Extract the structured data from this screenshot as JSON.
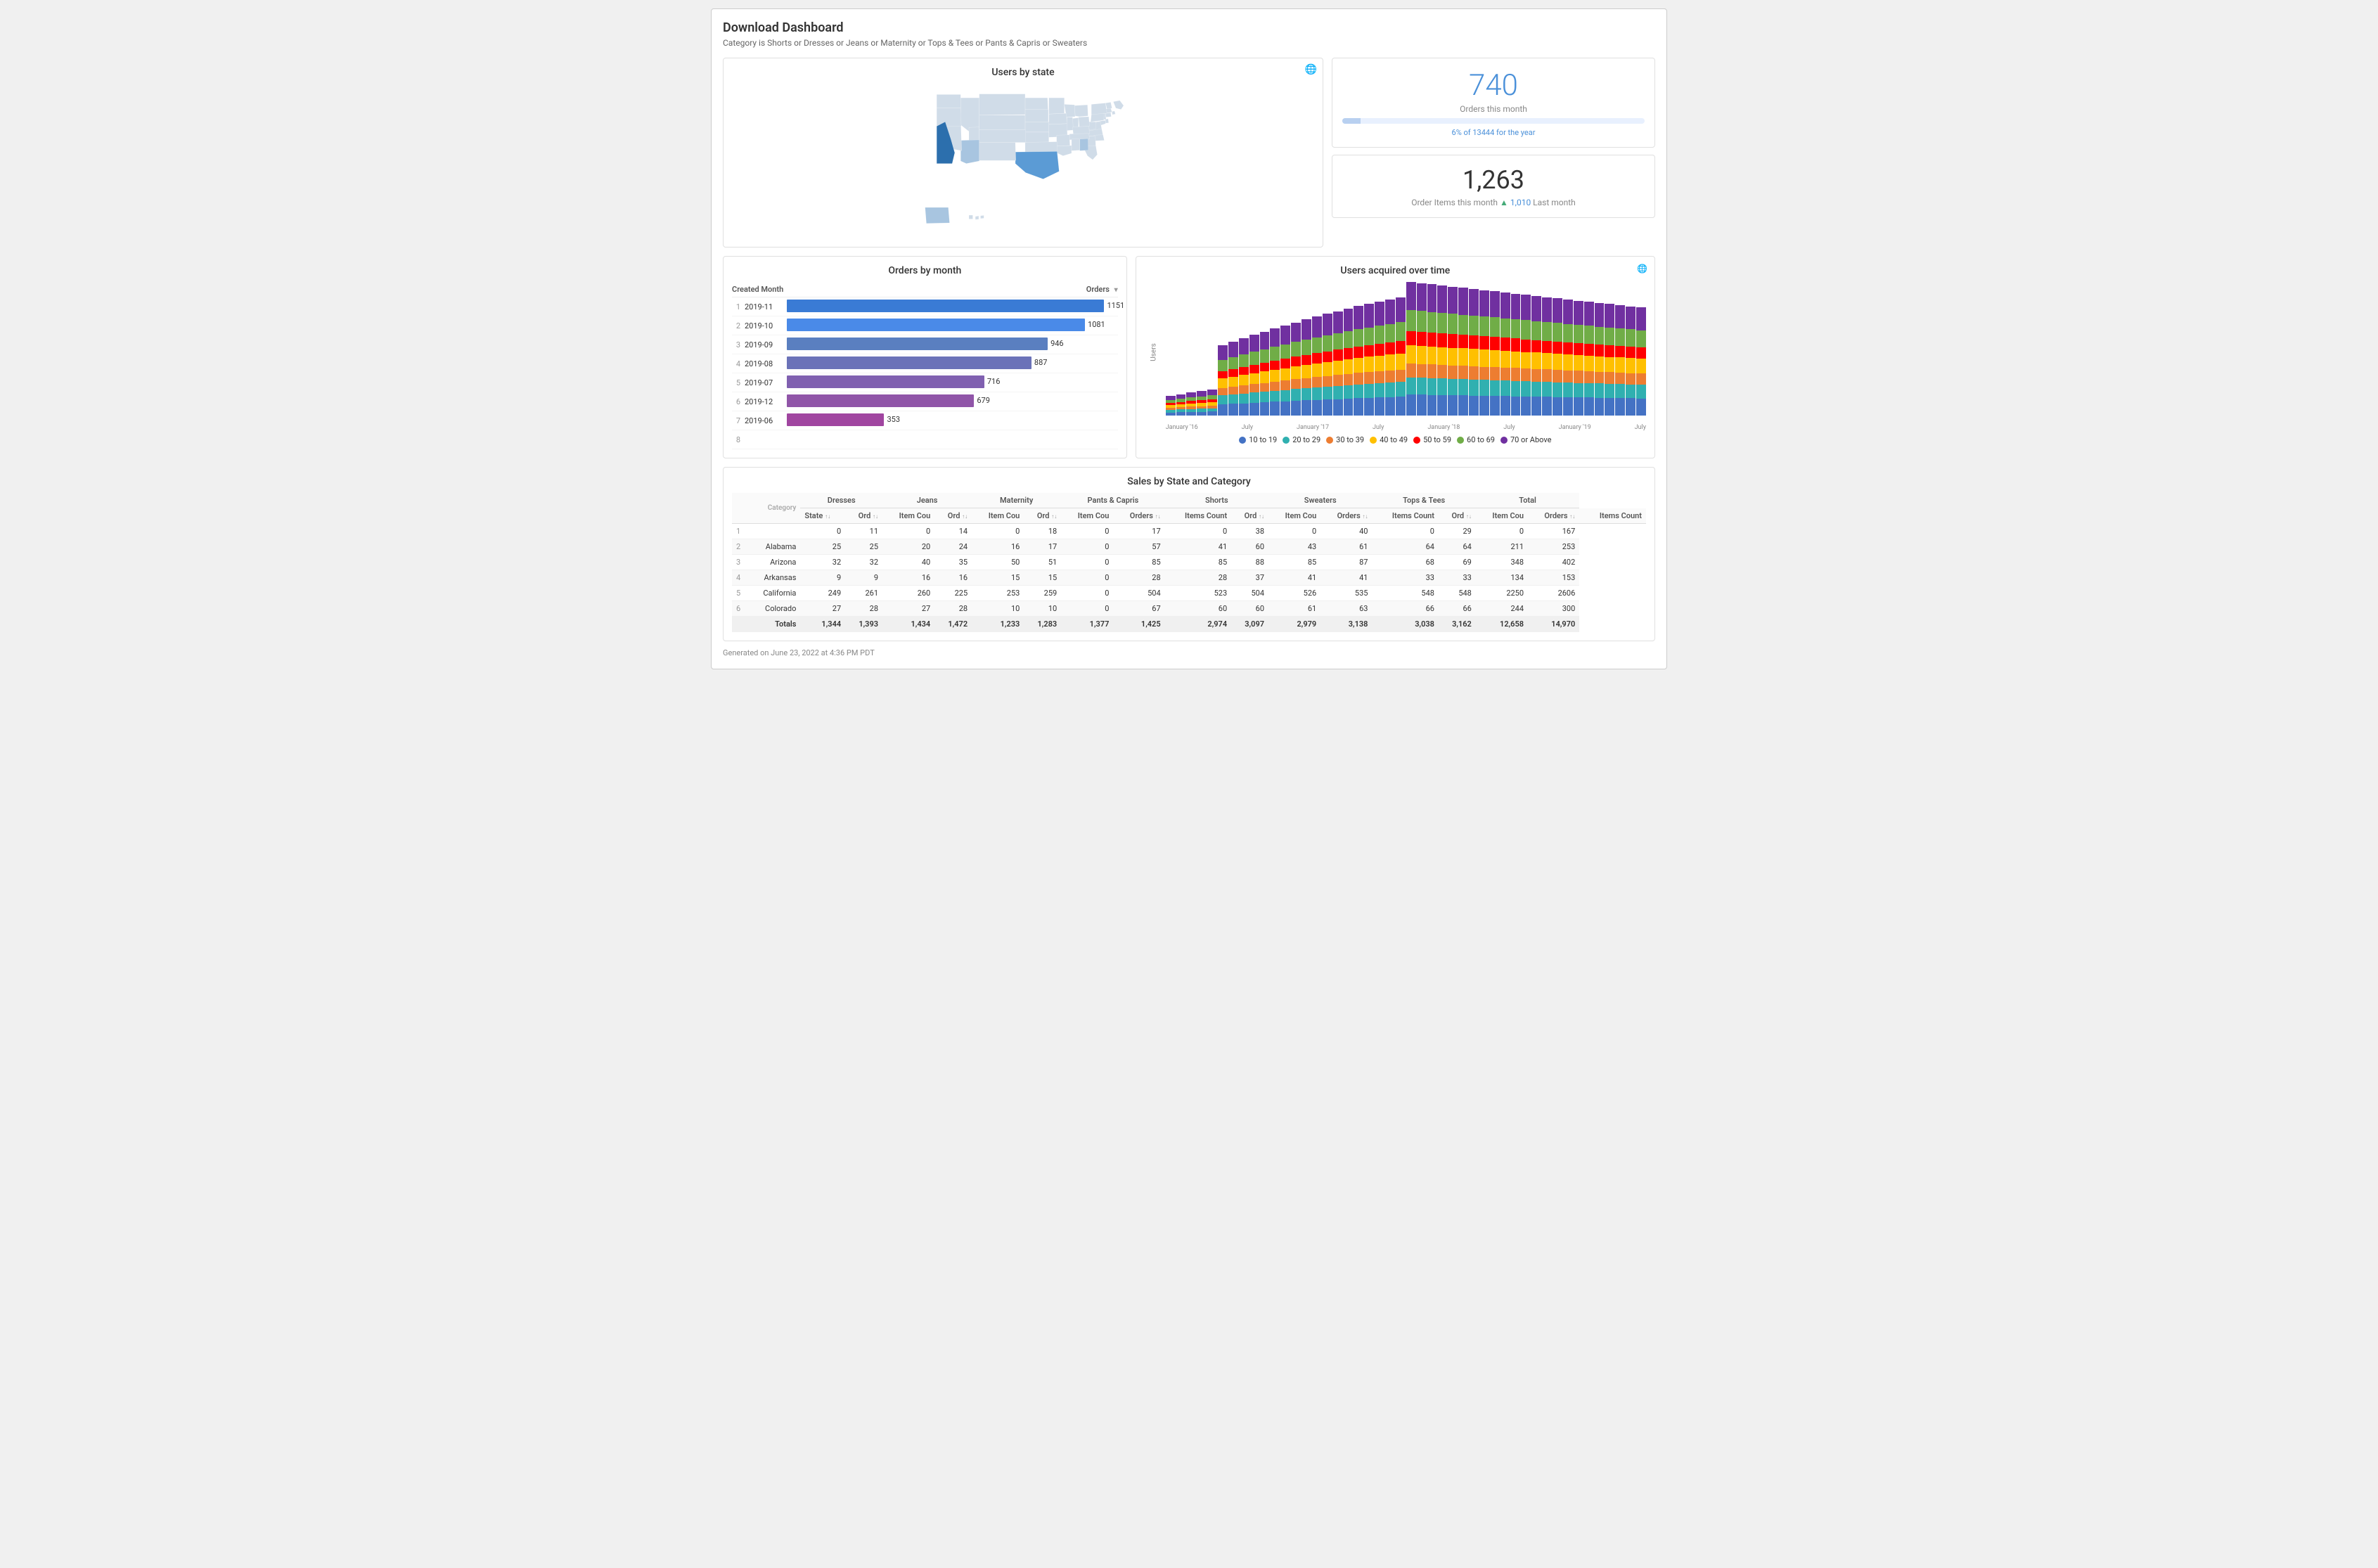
{
  "dashboard": {
    "title": "Download Dashboard",
    "subtitle": "Category is Shorts or Dresses or Jeans or Maternity or Tops & Tees or Pants & Capris or Sweaters",
    "footer": "Generated on June 23, 2022 at 4:36 PM PDT"
  },
  "map": {
    "title": "Users by state"
  },
  "metrics": {
    "orders_number": "740",
    "orders_label": "Orders this month",
    "year_label": "6% of 13444 for the year",
    "items_number": "1,263",
    "items_label": "Order Items this month",
    "items_sub": "Last month",
    "items_last_month": "1,010"
  },
  "orders_chart": {
    "title": "Orders by month",
    "col1": "Created Month",
    "col2": "Orders",
    "rows": [
      {
        "num": "1",
        "month": "2019-11",
        "value": 1151,
        "max": 1200
      },
      {
        "num": "2",
        "month": "2019-10",
        "value": 1081,
        "max": 1200
      },
      {
        "num": "3",
        "month": "2019-09",
        "value": 946,
        "max": 1200
      },
      {
        "num": "4",
        "month": "2019-08",
        "value": 887,
        "max": 1200
      },
      {
        "num": "5",
        "month": "2019-07",
        "value": 716,
        "max": 1200
      },
      {
        "num": "6",
        "month": "2019-12",
        "value": 679,
        "max": 1200
      },
      {
        "num": "7",
        "month": "2019-06",
        "value": 353,
        "max": 1200
      },
      {
        "num": "8",
        "month": "",
        "value": 0,
        "max": 1200
      }
    ],
    "bar_colors": [
      "#3a7bd5",
      "#4a8ae8",
      "#5a7fc0",
      "#6b72b8",
      "#8060b0",
      "#9055a8",
      "#a045a0",
      "#b03898"
    ]
  },
  "users_chart": {
    "title": "Users acquired over time",
    "y_label": "Users",
    "y_max": 250,
    "x_labels": [
      "January '16",
      "July",
      "January '17",
      "July",
      "January '18",
      "July",
      "January '19",
      "July"
    ],
    "legend": [
      {
        "label": "10 to 19",
        "color": "#4472c4"
      },
      {
        "label": "20 to 29",
        "color": "#30b0b0"
      },
      {
        "label": "30 to 39",
        "color": "#ed7d31"
      },
      {
        "label": "40 to 49",
        "color": "#ffc000"
      },
      {
        "label": "50 to 59",
        "color": "#ff0000"
      },
      {
        "label": "60 to 69",
        "color": "#70ad47"
      },
      {
        "label": "70 or Above",
        "color": "#7030a0"
      }
    ]
  },
  "sales_table": {
    "title": "Sales by State and Category",
    "categories": [
      "Dresses",
      "Jeans",
      "Maternity",
      "Pants & Capris",
      "Shorts",
      "Sweaters",
      "Tops & Tees",
      "Total"
    ],
    "sub_cols": [
      "Orders",
      "Items Count"
    ],
    "rows": [
      {
        "num": "1",
        "state": "",
        "dresses_ord": 0,
        "dresses_ic": 11,
        "jeans_ord": 0,
        "jeans_ic": 14,
        "mat_ord": 0,
        "mat_ic": 18,
        "pc_ord": 0,
        "pc_ic": 17,
        "shorts_ord": 0,
        "shorts_ic": 38,
        "sw_ord": 0,
        "sw_ic": 40,
        "tt_ord": 0,
        "tt_ic": 29,
        "tot_ord": 0,
        "tot_ic": 167
      },
      {
        "num": "2",
        "state": "Alabama",
        "dresses_ord": 25,
        "dresses_ic": 25,
        "jeans_ord": 20,
        "jeans_ic": 24,
        "mat_ord": 16,
        "mat_ic": 17,
        "pc_ord": 0,
        "pc_ic": 57,
        "shorts_ord": 41,
        "shorts_ic": 60,
        "sw_ord": 43,
        "sw_ic": 61,
        "tt_ord": 64,
        "tt_ic": 64,
        "tot_ord": 211,
        "tot_ic": 253
      },
      {
        "num": "3",
        "state": "Arizona",
        "dresses_ord": 32,
        "dresses_ic": 32,
        "jeans_ord": 40,
        "jeans_ic": 35,
        "mat_ord": 50,
        "mat_ic": 51,
        "pc_ord": 0,
        "pc_ic": 85,
        "shorts_ord": 85,
        "shorts_ic": 88,
        "sw_ord": 85,
        "sw_ic": 87,
        "tt_ord": 68,
        "tt_ic": 69,
        "tot_ord": 348,
        "tot_ic": 402
      },
      {
        "num": "4",
        "state": "Arkansas",
        "dresses_ord": 9,
        "dresses_ic": 9,
        "jeans_ord": 16,
        "jeans_ic": 16,
        "mat_ord": 15,
        "mat_ic": 15,
        "pc_ord": 0,
        "pc_ic": 28,
        "shorts_ord": 28,
        "shorts_ic": 37,
        "sw_ord": 41,
        "sw_ic": 41,
        "tt_ord": 33,
        "tt_ic": 33,
        "tot_ord": 134,
        "tot_ic": 153
      },
      {
        "num": "5",
        "state": "California",
        "dresses_ord": 249,
        "dresses_ic": 261,
        "jeans_ord": 260,
        "jeans_ic": 225,
        "mat_ord": 253,
        "mat_ic": 259,
        "pc_ord": 0,
        "pc_ic": 504,
        "shorts_ord": 523,
        "shorts_ic": 504,
        "sw_ord": 526,
        "sw_ic": 535,
        "tt_ord": 548,
        "tt_ic": 548,
        "tot_ord": 2250,
        "tot_ic": 2606
      },
      {
        "num": "6",
        "state": "Colorado",
        "dresses_ord": 27,
        "dresses_ic": 28,
        "jeans_ord": 27,
        "jeans_ic": 28,
        "mat_ord": 10,
        "mat_ic": 10,
        "pc_ord": 0,
        "pc_ic": 67,
        "shorts_ord": 60,
        "shorts_ic": 60,
        "sw_ord": 61,
        "sw_ic": 63,
        "tt_ord": 66,
        "tt_ic": 66,
        "tot_ord": 244,
        "tot_ic": 300
      }
    ],
    "totals": {
      "state": "Totals",
      "dresses_ord": 1344,
      "dresses_ic": 1393,
      "jeans_ord": 1434,
      "jeans_ic": 1472,
      "mat_ord": 1233,
      "mat_ic": 1283,
      "pc_ord": 1377,
      "pc_ic": 1425,
      "shorts_ord": 2974,
      "shorts_ic": 3097,
      "sw_ord": 2979,
      "sw_ic": 3138,
      "tt_ord": 3038,
      "tt_ic": 3162,
      "tot_ord": 12658,
      "tot_ic": 14970
    }
  }
}
